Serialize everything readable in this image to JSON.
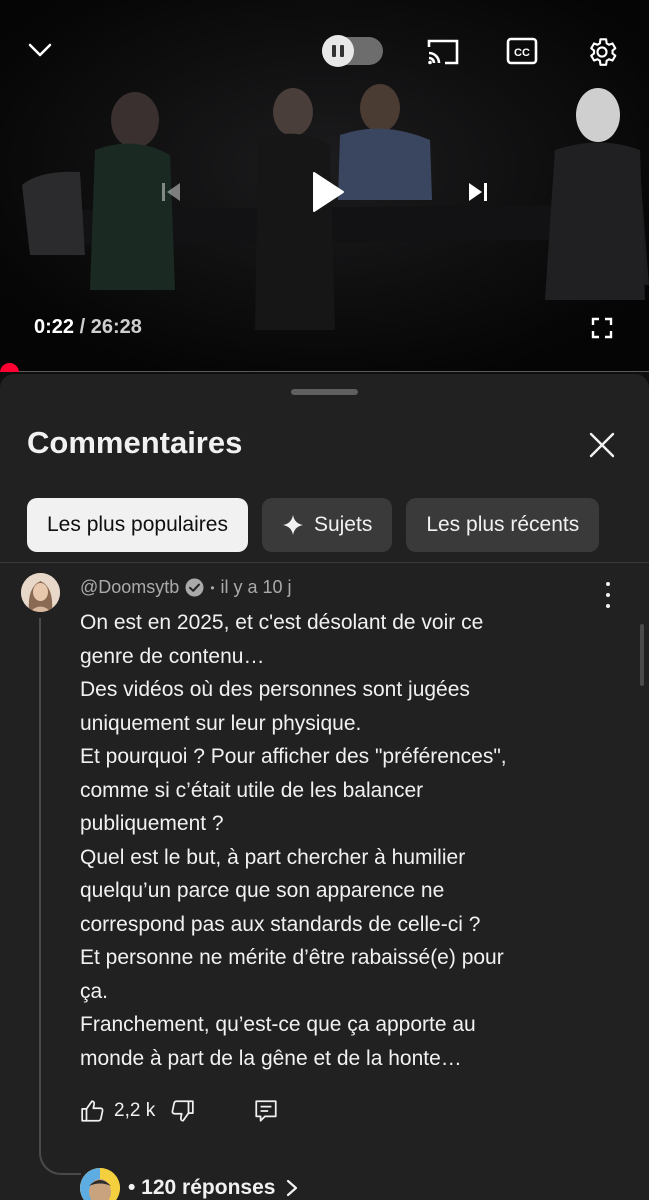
{
  "player": {
    "current_time": "0:22",
    "separator": "/",
    "duration": "26:28",
    "progress_fraction": 0.014,
    "icons": [
      "chevron-down-icon",
      "autoplay-toggle",
      "cast-icon",
      "captions-icon",
      "gear-icon",
      "previous-icon",
      "play-icon",
      "next-icon",
      "fullscreen-icon"
    ],
    "captions_label": "CC"
  },
  "sheet": {
    "title": "Commentaires",
    "chips": [
      {
        "label": "Les plus populaires",
        "active": true
      },
      {
        "label": "Sujets",
        "active": false
      },
      {
        "label": "Les plus récents",
        "active": false
      }
    ]
  },
  "comment": {
    "author": "@Doomsytb",
    "verified": true,
    "dot": "•",
    "age": "il y a 10 j",
    "lines": [
      "On est en 2025, et c'est désolant de voir ce",
      "genre de contenu…",
      "Des vidéos où des personnes sont jugées",
      "uniquement sur leur physique.",
      "Et pourquoi ? Pour afficher des \"préférences\",",
      "comme si c’était utile de les balancer",
      "publiquement ?",
      "Quel est le but, à part chercher à humilier",
      "quelqu’un parce que son apparence ne",
      "correspond pas aux standards de celle-ci ?",
      "Et personne ne mérite d’être rabaissé(e) pour",
      "ça.",
      "Franchement, qu’est-ce que ça apporte au",
      "monde à part de la gêne et de la honte…"
    ],
    "likes": "2,2 k",
    "replies": "• 120 réponses"
  },
  "colors": {
    "background": "#0f0f0f",
    "sheet": "#212121",
    "accent_red": "#ff0033",
    "chip": "#3a3a3a",
    "chip_active": "#f1f1f1"
  }
}
